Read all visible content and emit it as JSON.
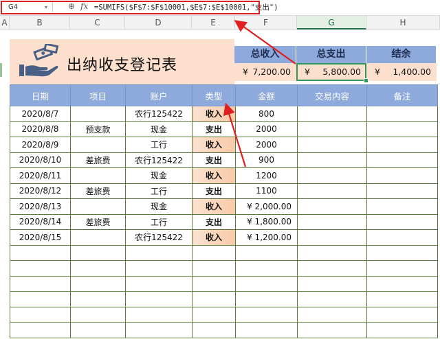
{
  "formula_bar": {
    "name_box": "G4",
    "zoom_icon": "zoom-icon",
    "fx_label": "fx",
    "formula": "=SUMIFS($F$7:$F$10001,$E$7:$E$10001,\"支出\")"
  },
  "column_headers": [
    "A",
    "B",
    "C",
    "D",
    "E",
    "F",
    "G",
    "H"
  ],
  "title": "出纳收支登记表",
  "summary": {
    "headers": [
      "总收入",
      "总支出",
      "结余"
    ],
    "values": [
      {
        "currency": "¥",
        "amount": "7,200.00"
      },
      {
        "currency": "¥",
        "amount": "5,800.00"
      },
      {
        "currency": "¥",
        "amount": "1,400.00"
      }
    ]
  },
  "table": {
    "headers": [
      "日期",
      "项目",
      "账户",
      "类型",
      "金额",
      "交易内容",
      "备注"
    ],
    "rows": [
      {
        "date": "2020/8/7",
        "item": "",
        "account": "农行125422",
        "type": "收入",
        "amount": "800"
      },
      {
        "date": "2020/8/8",
        "item": "预支款",
        "account": "现金",
        "type": "支出",
        "amount": "2000"
      },
      {
        "date": "2020/8/9",
        "item": "",
        "account": "工行",
        "type": "收入",
        "amount": "2000"
      },
      {
        "date": "2020/8/10",
        "item": "差旅费",
        "account": "农行125422",
        "type": "支出",
        "amount": "900"
      },
      {
        "date": "2020/8/11",
        "item": "",
        "account": "现金",
        "type": "收入",
        "amount": "1200"
      },
      {
        "date": "2020/8/12",
        "item": "差旅费",
        "account": "工行",
        "type": "支出",
        "amount": "1100"
      },
      {
        "date": "2020/8/13",
        "item": "",
        "account": "现金",
        "type": "收入",
        "amount": "¥ 2,000.00"
      },
      {
        "date": "2020/8/14",
        "item": "差旅费",
        "account": "工行",
        "type": "支出",
        "amount": "¥ 1,800.00"
      },
      {
        "date": "2020/8/15",
        "item": "",
        "account": "农行125422",
        "type": "收入",
        "amount": "¥ 1,200.00"
      }
    ],
    "empty_rows": 6
  },
  "colors": {
    "header_blue": "#8ea9db",
    "banner_peach": "#fcdfcd",
    "income_fill": "#f8c9a6",
    "annotation_red": "#e02020",
    "selection_green": "#2e9a5a"
  },
  "icons": {
    "logo": "money-hand-icon"
  }
}
